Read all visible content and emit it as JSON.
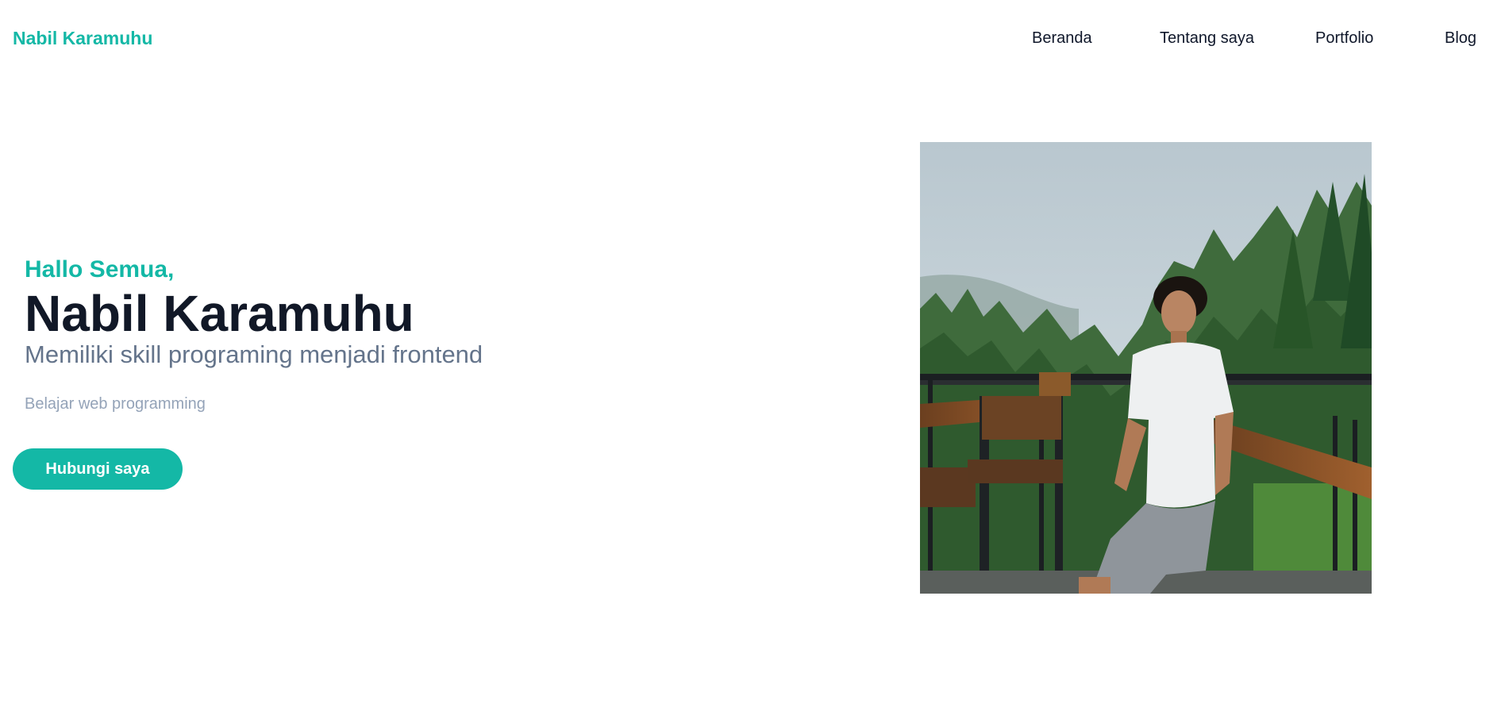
{
  "navbar": {
    "brand": "Nabil Karamuhu",
    "links": [
      {
        "label": "Beranda"
      },
      {
        "label": "Tentang saya"
      },
      {
        "label": "Portfolio"
      },
      {
        "label": "Blog"
      }
    ]
  },
  "hero": {
    "greeting": "Hallo Semua,",
    "name": "Nabil Karamuhu",
    "subtitle": "Memiliki skill programing menjadi frontend",
    "description": "Belajar web programming",
    "cta_label": "Hubungi saya"
  },
  "colors": {
    "accent": "#14b8a6",
    "heading": "#111827",
    "subtitle": "#64748b",
    "muted": "#94a3b8"
  }
}
